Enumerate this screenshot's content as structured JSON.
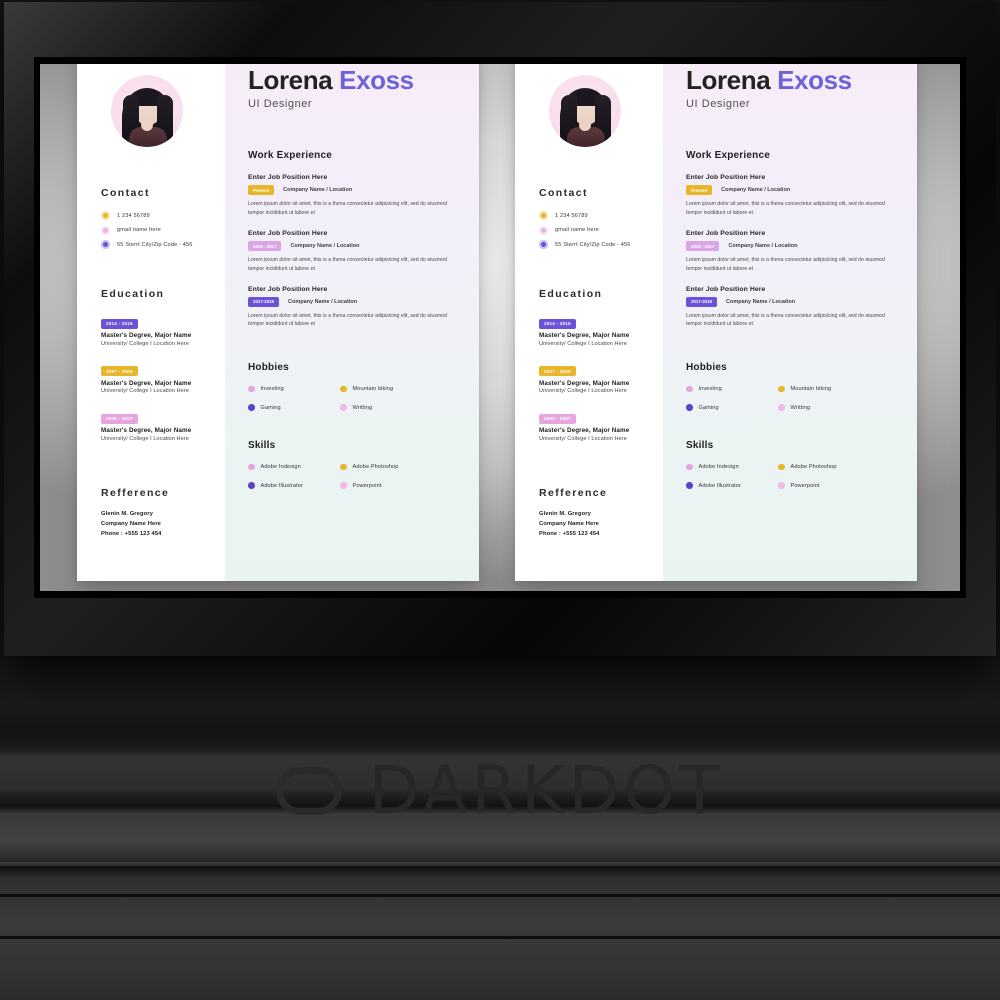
{
  "scene": {
    "watermark": {
      "text": "DARKDOT",
      "logo_icon": "darkdot-logo-icon"
    }
  },
  "resume": {
    "name_first": "Lorena",
    "name_last": "Exoss",
    "role": "UI Designer",
    "avatar_icon": "profile-photo",
    "contact": {
      "heading": "Contact",
      "items": [
        {
          "icon": "phone-icon",
          "text": "1 234 56789",
          "color": "#e8b629"
        },
        {
          "icon": "email-icon",
          "text": "gmail name here",
          "color": "#e7b5e3"
        },
        {
          "icon": "location-icon",
          "text": "55 Sterrt City/Zip Code - 456",
          "color": "#6c52d8"
        }
      ]
    },
    "education": {
      "heading": "Education",
      "items": [
        {
          "years": "2014 - 2015",
          "badge_color": "#6c52d8",
          "degree": "Master's Degree, Major Name",
          "school": "University/ College I Location Here"
        },
        {
          "years": "2007 - 2009",
          "badge_color": "#e8b629",
          "degree": "Master's Degree, Major Name",
          "school": "University/ College I Location Here"
        },
        {
          "years": "2005 - 2007",
          "badge_color": "#e7a5e0",
          "degree": "Master's Degree, Major Name",
          "school": "University/ College I Location Here"
        }
      ]
    },
    "reference": {
      "heading": "Refference",
      "person": "Glenin M. Gregory",
      "company": "Company Name Here",
      "phone": "Phone : +555 123 454"
    },
    "work": {
      "heading": "Work Experience",
      "items": [
        {
          "position": "Enter Job Position Here",
          "period": "Present",
          "badge_color": "#e8b629",
          "company": "Company Name / Location",
          "description": "Lorem ipsum dolor sit amet, this is a thena  consectetur adipisicing elit, sed do eiusmod tempor incididunt ut labore et"
        },
        {
          "position": "Enter Job Position Here",
          "period": "2015 - 2017",
          "badge_color": "#dba6e6",
          "company": "Company Name / Location",
          "description": "Lorem ipsum dolor sit amet, this is a thena  consectetur adipisicing elit, sed do eiusmod tempor incididunt ut labore et"
        },
        {
          "position": "Enter Job Position Here",
          "period": "2017-2019",
          "badge_color": "#6c52d8",
          "company": "Company Name / Location",
          "description": "Lorem ipsum dolor sit amet, this is a thena  consectetur adipisicing elit, sed do eiusmod tempor incididunt ut labore et"
        }
      ]
    },
    "hobbies": {
      "heading": "Hobbies",
      "items": [
        {
          "label": "Investing",
          "color": "#e7a5e0"
        },
        {
          "label": "Mountain biking",
          "color": "#e8b629"
        },
        {
          "label": "Gaming",
          "color": "#5b44c9"
        },
        {
          "label": "Writting",
          "color": "#efb9e8"
        }
      ]
    },
    "skills": {
      "heading": "Skills",
      "items": [
        {
          "label": "Adobe Indesign",
          "color": "#e7a5e0"
        },
        {
          "label": "Adobe Photoshop",
          "color": "#e8b629"
        },
        {
          "label": "Adobe Illustrator",
          "color": "#5b44c9"
        },
        {
          "label": "Powerpoint",
          "color": "#efb9e8"
        }
      ]
    }
  }
}
